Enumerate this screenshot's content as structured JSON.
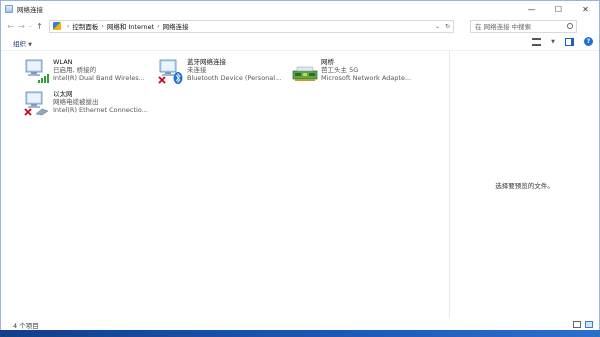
{
  "window": {
    "title": "网络连接",
    "controls": {
      "minimize": "—",
      "maximize": "☐",
      "close": "✕"
    }
  },
  "address": {
    "breadcrumbs": [
      "控制面板",
      "网络和 Internet",
      "网络连接"
    ],
    "search_placeholder": "在 网络连接 中搜索"
  },
  "toolbar": {
    "organize_label": "组织"
  },
  "connections": [
    {
      "name": "WLAN",
      "status": "已启用, 桥接的",
      "device": "Intel(R) Dual Band Wireles...",
      "icon": "wlan-adapter-icon",
      "state": "connected"
    },
    {
      "name": "蓝牙网络连接",
      "status": "未连接",
      "device": "Bluetooth Device (Personal...",
      "icon": "bluetooth-adapter-icon",
      "state": "disconnected"
    },
    {
      "name": "网桥",
      "status": "芭工头主 5G",
      "device": "Microsoft Network Adapte...",
      "icon": "bridge-adapter-icon",
      "state": "connected"
    },
    {
      "name": "以太网",
      "status": "网络电缆被拔出",
      "device": "Intel(R) Ethernet Connectio...",
      "icon": "ethernet-adapter-icon",
      "state": "disconnected"
    }
  ],
  "preview": {
    "message": "选择要预览的文件。"
  },
  "status_bar": {
    "item_count": "4 个项目"
  },
  "colors": {
    "accent": "#1e6fd6",
    "error_x": "#d0021b",
    "signal_green": "#2e9e3a",
    "desktop": "#1d4f9c"
  }
}
